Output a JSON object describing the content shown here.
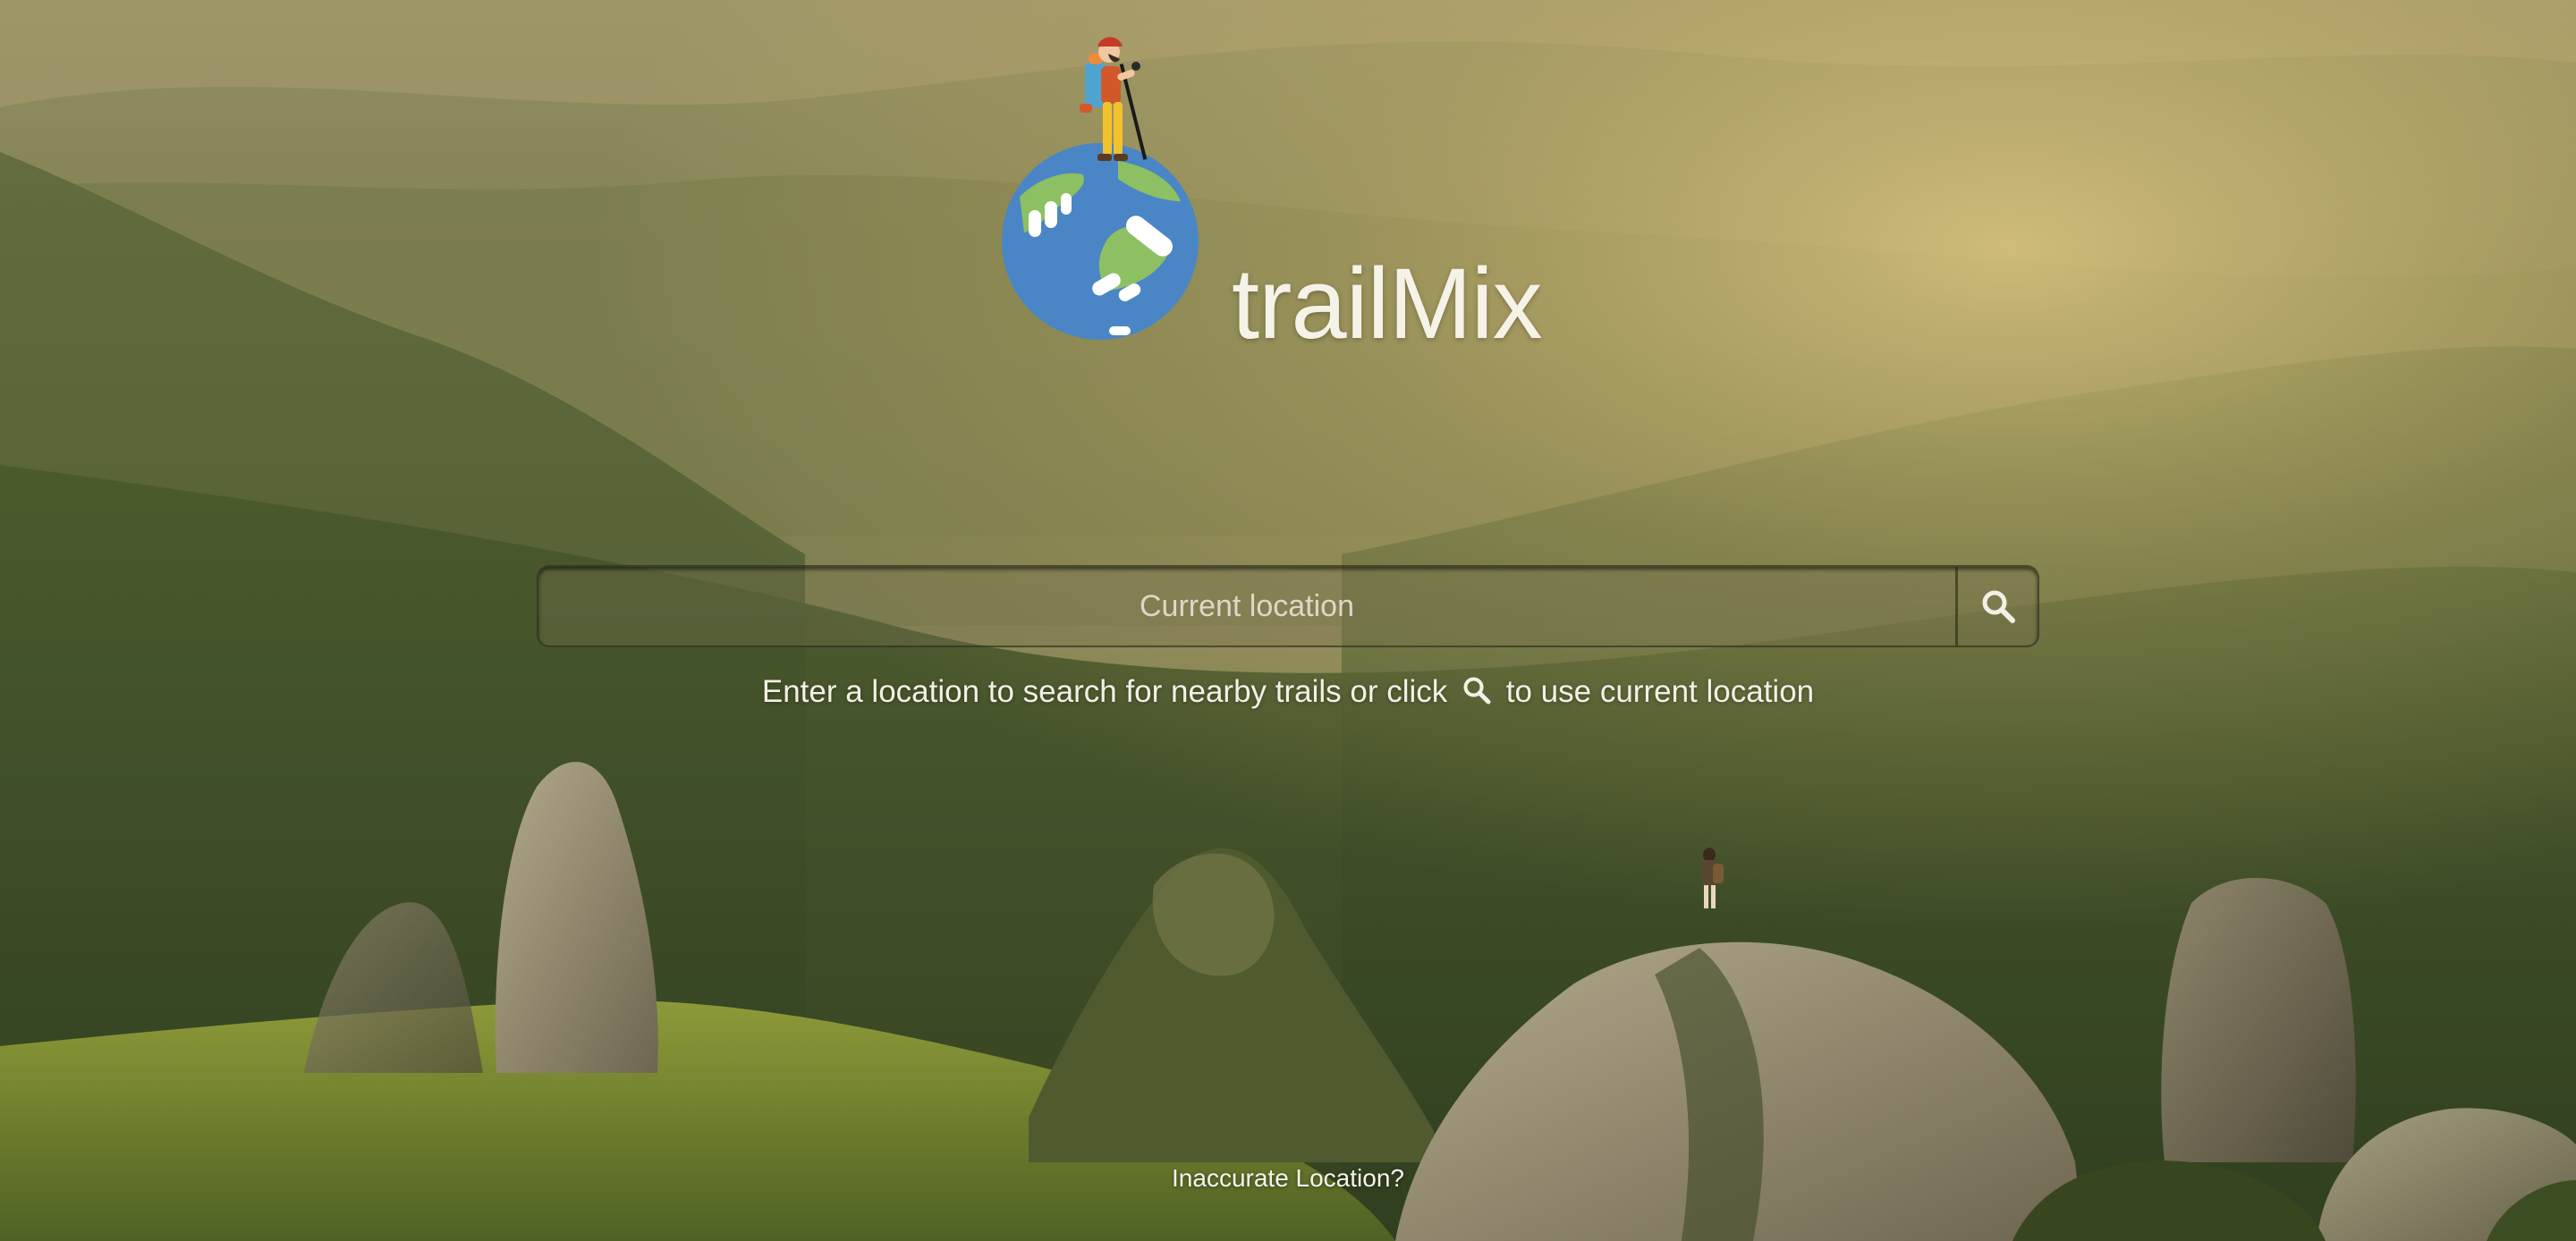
{
  "brand": {
    "name": "trailMix"
  },
  "search": {
    "placeholder": "Current location",
    "value": ""
  },
  "hint": {
    "before_icon": "Enter a location to search for nearby trails or click",
    "after_icon": "to use current location",
    "icon": "search-icon"
  },
  "footer": {
    "inaccurate_link": "Inaccurate Location?"
  },
  "colors": {
    "globe_blue": "#4a86c5",
    "globe_green": "#8dc063",
    "text_light": "#f5f2e8"
  },
  "icons": {
    "search_button": "search-icon",
    "logo": "hiker-on-globe-logo"
  }
}
